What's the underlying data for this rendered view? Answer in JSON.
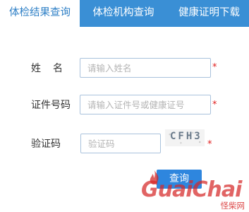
{
  "tabs": [
    {
      "label": "体检结果查询",
      "active": true
    },
    {
      "label": "体检机构查询",
      "active": false
    },
    {
      "label": "健康证明下载",
      "active": false
    }
  ],
  "form": {
    "name": {
      "label": "姓名",
      "placeholder": "请输入姓名",
      "value": "",
      "required_mark": "*"
    },
    "id_number": {
      "label": "证件号码",
      "placeholder": "请输入证件号或健康证号",
      "value": "",
      "required_mark": "*"
    },
    "captcha": {
      "label": "验证码",
      "placeholder": "验证码",
      "value": "",
      "required_mark": "*",
      "image_text": "CFH3"
    }
  },
  "submit_label": "查询",
  "watermark": {
    "brand": "GuaiChai",
    "sub": "怪柴网"
  },
  "colors": {
    "tab_bar": "#3a8fd5",
    "active_tab_text": "#2d7fc6",
    "button": "#2e86de",
    "required": "#e02020",
    "watermark": "#d62828"
  }
}
